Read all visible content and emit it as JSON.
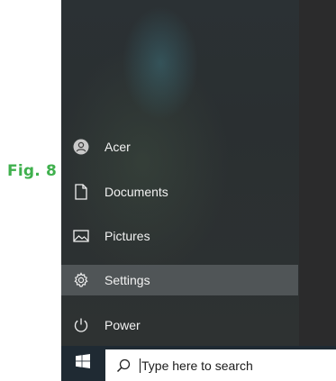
{
  "figure_label": "Fig. 8",
  "start_menu": {
    "items": [
      {
        "label": "Acer",
        "icon": "user-icon"
      },
      {
        "label": "Documents",
        "icon": "document-icon"
      },
      {
        "label": "Pictures",
        "icon": "pictures-icon"
      },
      {
        "label": "Settings",
        "icon": "gear-icon",
        "highlighted": true
      },
      {
        "label": "Power",
        "icon": "power-icon"
      }
    ]
  },
  "taskbar": {
    "start_icon": "windows-logo-icon",
    "search_placeholder": "Type here to search"
  },
  "colors": {
    "figure_label": "#3fb04d",
    "start_background": "#2b3134",
    "taskbar": "#1f2a33",
    "highlight": "#6e7376"
  }
}
